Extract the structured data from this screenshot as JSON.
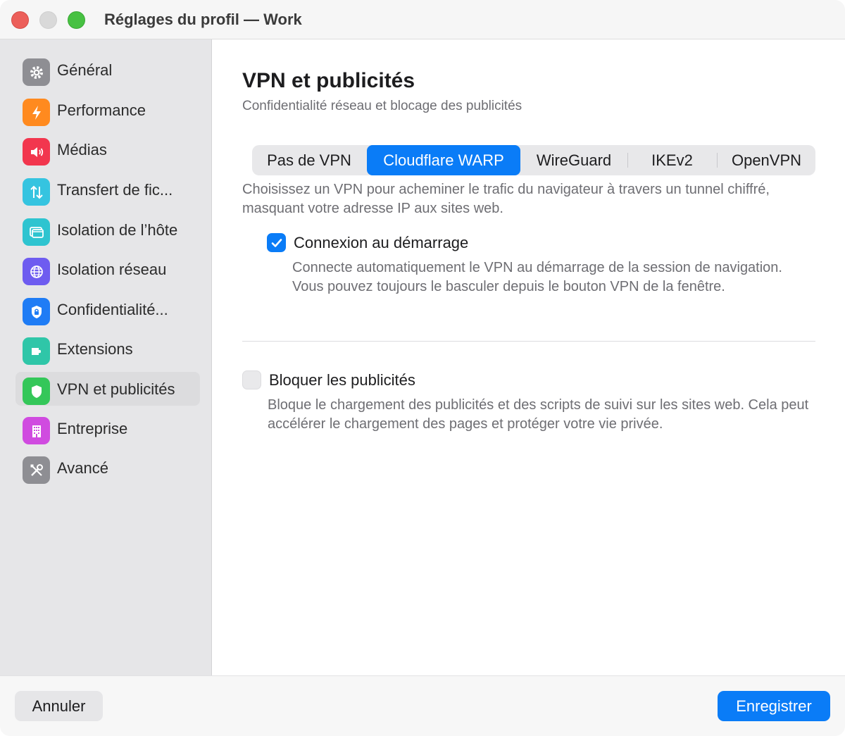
{
  "window": {
    "title": "Réglages du profil — Work"
  },
  "sidebar": {
    "items": [
      {
        "label": "Général",
        "icon": "gear-icon",
        "color": "#8e8e93"
      },
      {
        "label": "Performance",
        "icon": "bolt-icon",
        "color": "#ff8a1f"
      },
      {
        "label": "Médias",
        "icon": "speaker-icon",
        "color": "#f2364e"
      },
      {
        "label": "Transfert de fic...",
        "icon": "arrows-up-down-icon",
        "color": "#35c4e0"
      },
      {
        "label": "Isolation de l’hôte",
        "icon": "window-icon",
        "color": "#2ec4d0"
      },
      {
        "label": "Isolation réseau",
        "icon": "globe-icon",
        "color": "#6e5cf0"
      },
      {
        "label": "Confidentialité...",
        "icon": "lock-shield-icon",
        "color": "#1f7cf5"
      },
      {
        "label": "Extensions",
        "icon": "puzzle-icon",
        "color": "#2fc6a8"
      },
      {
        "label": "VPN et publicités",
        "icon": "shield-icon",
        "color": "#34c759"
      },
      {
        "label": "Entreprise",
        "icon": "building-icon",
        "color": "#d04be0"
      },
      {
        "label": "Avancé",
        "icon": "tools-icon",
        "color": "#8e8e93"
      }
    ],
    "active_index": 8
  },
  "main": {
    "title": "VPN et publicités",
    "subtitle": "Confidentialité réseau et blocage des publicités",
    "vpn_tabs": [
      "Pas de VPN",
      "Cloudflare WARP",
      "WireGuard",
      "IKEv2",
      "OpenVPN"
    ],
    "vpn_selected": "Cloudflare WARP",
    "vpn_description": "Choisissez un VPN pour acheminer le trafic du navigateur à travers un tunnel chiffré, masquant votre adresse IP aux sites web.",
    "connect_on_start": {
      "label": "Connexion au démarrage",
      "checked": true,
      "description": "Connecte automatiquement le VPN au démarrage de la session de navigation. Vous pouvez toujours le basculer depuis le bouton VPN de la fenêtre."
    },
    "block_ads": {
      "label": "Bloquer les publicités",
      "checked": false,
      "description": "Bloque le chargement des publicités et des scripts de suivi sur les sites web. Cela peut accélérer le chargement des pages et protéger votre vie privée."
    }
  },
  "footer": {
    "cancel_label": "Annuler",
    "save_label": "Enregistrer"
  },
  "colors": {
    "accent": "#0a7cf7",
    "sidebar_bg": "#e6e6e8"
  }
}
